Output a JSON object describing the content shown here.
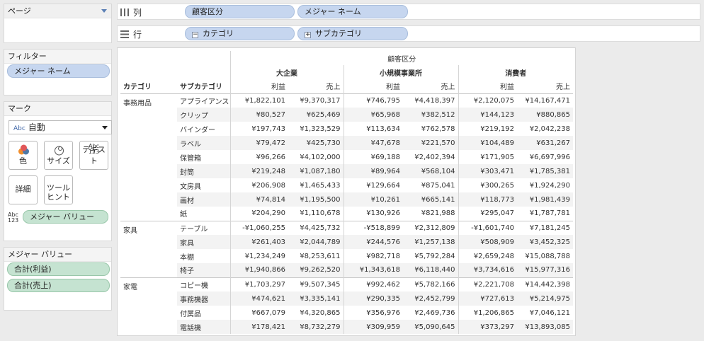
{
  "pages": {
    "title": "ページ"
  },
  "columns_shelf": {
    "label": "列",
    "pills": [
      "顧客区分",
      "メジャー ネーム"
    ]
  },
  "rows_shelf": {
    "label": "行",
    "pills": [
      "カテゴリ",
      "サブカテゴリ"
    ]
  },
  "filters": {
    "title": "フィルター",
    "pills": [
      "メジャー ネーム"
    ]
  },
  "marks": {
    "title": "マーク",
    "type_selected": "自動",
    "buttons": {
      "color": "色",
      "size": "サイズ",
      "text": "テキスト",
      "detail": "詳細",
      "tooltip_line1": "ツール",
      "tooltip_line2": "ヒント"
    },
    "text_pill": "メジャー バリュー"
  },
  "measure_values": {
    "title": "メジャー バリュー",
    "pills": [
      "合計(利益)",
      "合計(売上)"
    ]
  },
  "table": {
    "top_header": "顧客区分",
    "segments": [
      "大企業",
      "小規模事業所",
      "消費者"
    ],
    "row_headers": [
      "カテゴリ",
      "サブカテゴリ"
    ],
    "measures": [
      "利益",
      "売上"
    ],
    "categories": [
      {
        "name": "事務用品",
        "rows": [
          {
            "sub": "アプライアンス",
            "v": [
              "¥1,822,101",
              "¥9,370,317",
              "¥746,795",
              "¥4,418,397",
              "¥2,120,075",
              "¥14,167,471"
            ]
          },
          {
            "sub": "クリップ",
            "v": [
              "¥80,527",
              "¥625,469",
              "¥65,968",
              "¥382,512",
              "¥144,123",
              "¥880,865"
            ]
          },
          {
            "sub": "バインダー",
            "v": [
              "¥197,743",
              "¥1,323,529",
              "¥113,634",
              "¥762,578",
              "¥219,192",
              "¥2,042,238"
            ]
          },
          {
            "sub": "ラベル",
            "v": [
              "¥79,472",
              "¥425,730",
              "¥47,678",
              "¥221,570",
              "¥104,489",
              "¥631,267"
            ]
          },
          {
            "sub": "保管箱",
            "v": [
              "¥96,266",
              "¥4,102,000",
              "¥69,188",
              "¥2,402,394",
              "¥171,905",
              "¥6,697,996"
            ]
          },
          {
            "sub": "封筒",
            "v": [
              "¥219,248",
              "¥1,087,180",
              "¥89,964",
              "¥568,104",
              "¥303,471",
              "¥1,785,381"
            ]
          },
          {
            "sub": "文房具",
            "v": [
              "¥206,908",
              "¥1,465,433",
              "¥129,664",
              "¥875,041",
              "¥300,265",
              "¥1,924,290"
            ]
          },
          {
            "sub": "画材",
            "v": [
              "¥74,814",
              "¥1,195,500",
              "¥10,261",
              "¥665,141",
              "¥118,773",
              "¥1,981,439"
            ]
          },
          {
            "sub": "紙",
            "v": [
              "¥204,290",
              "¥1,110,678",
              "¥130,926",
              "¥821,988",
              "¥295,047",
              "¥1,787,781"
            ]
          }
        ]
      },
      {
        "name": "家具",
        "rows": [
          {
            "sub": "テーブル",
            "v": [
              "-¥1,060,255",
              "¥4,425,732",
              "-¥518,899",
              "¥2,312,809",
              "-¥1,601,740",
              "¥7,181,245"
            ]
          },
          {
            "sub": "家具",
            "v": [
              "¥261,403",
              "¥2,044,789",
              "¥244,576",
              "¥1,257,138",
              "¥508,909",
              "¥3,452,325"
            ]
          },
          {
            "sub": "本棚",
            "v": [
              "¥1,234,249",
              "¥8,253,611",
              "¥982,718",
              "¥5,792,284",
              "¥2,659,248",
              "¥15,088,788"
            ]
          },
          {
            "sub": "椅子",
            "v": [
              "¥1,940,866",
              "¥9,262,520",
              "¥1,343,618",
              "¥6,118,440",
              "¥3,734,616",
              "¥15,977,316"
            ]
          }
        ]
      },
      {
        "name": "家電",
        "rows": [
          {
            "sub": "コピー機",
            "v": [
              "¥1,703,297",
              "¥9,507,345",
              "¥992,462",
              "¥5,782,166",
              "¥2,221,708",
              "¥14,442,398"
            ]
          },
          {
            "sub": "事務機器",
            "v": [
              "¥474,621",
              "¥3,335,141",
              "¥290,335",
              "¥2,452,799",
              "¥727,613",
              "¥5,214,975"
            ]
          },
          {
            "sub": "付属品",
            "v": [
              "¥667,079",
              "¥4,320,865",
              "¥356,976",
              "¥2,469,736",
              "¥1,206,865",
              "¥7,046,121"
            ]
          },
          {
            "sub": "電話機",
            "v": [
              "¥178,421",
              "¥8,732,279",
              "¥309,959",
              "¥5,090,645",
              "¥373,297",
              "¥13,893,085"
            ]
          }
        ]
      }
    ]
  }
}
